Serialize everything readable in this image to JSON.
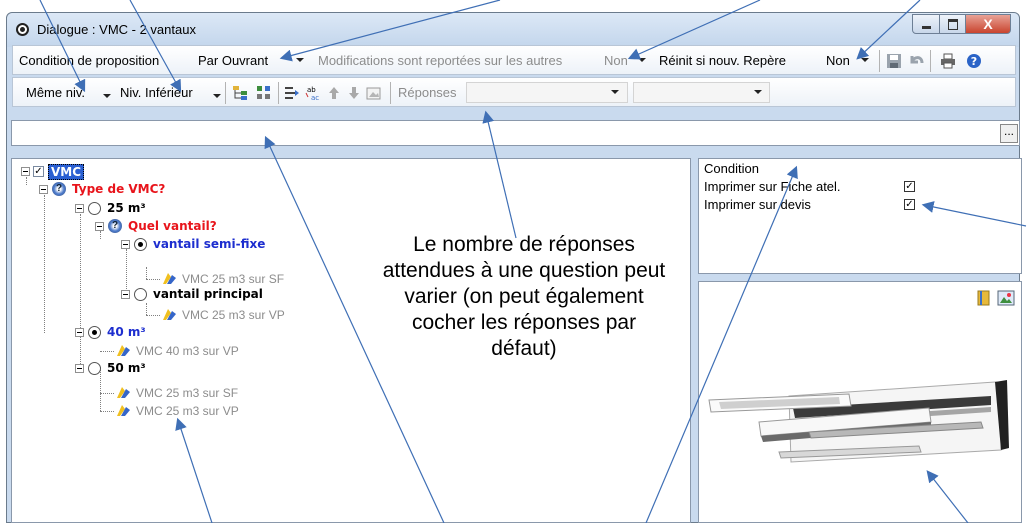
{
  "window": {
    "title": "Dialogue : VMC - 2 vantaux",
    "app_icon": "app-logo-icon",
    "controls": {
      "minimize": "minimize-icon",
      "maximize": "maximize-icon",
      "close": "X"
    }
  },
  "toolbar1": {
    "condition_label": "Condition de proposition",
    "condition_value": "Par Ouvrant",
    "modifications_label": "Modifications sont reportées sur les autres",
    "modifications_value": "Non",
    "reinit_label": "Réinit si nouv. Repère",
    "reinit_value": "Non",
    "icons": [
      "save-icon",
      "undo-icon",
      "print-icon",
      "help-icon"
    ]
  },
  "toolbar2": {
    "same_level": "Même niv.",
    "lower_level": "Niv. Inférieur",
    "icons": [
      "tree-expand-icon",
      "tree-grid-icon",
      "indent-icon",
      "rename-icon",
      "move-up-icon",
      "move-down-icon",
      "image-icon"
    ],
    "responses_label": "Réponses",
    "combo1_value": "",
    "combo2_value": ""
  },
  "formula_bar": {
    "value": "",
    "button": "..."
  },
  "tree": {
    "root": "VMC",
    "q1": "Type de VMC?",
    "a1": "25 m³",
    "q2": "Quel vantail?",
    "a2a": "vantail semi-fixe",
    "leaf1": "VMC 25 m3 sur SF",
    "a2b": "vantail principal",
    "leaf2": "VMC 25 m3 sur VP",
    "a3": "40 m³",
    "leaf3": "VMC 40 m3 sur VP",
    "a4": "50 m³",
    "leaf4": "VMC 25 m3 sur SF",
    "leaf5": "VMC 25 m3 sur VP"
  },
  "annotation": "Le nombre de réponses attendues à une question peut varier (on peut également cocher les réponses par défaut)",
  "condition_panel": {
    "title": "Condition",
    "print_sheet_label": "Imprimer sur Fiche atel.",
    "print_sheet_checked": true,
    "print_quote_label": "Imprimer sur devis",
    "print_quote_checked": true
  },
  "image_panel": {
    "icons": [
      "book-icon",
      "picture-icon"
    ]
  },
  "colors": {
    "question": "#e8141b",
    "selected_answer": "#1d2ecf",
    "leaf": "#8c8c8c",
    "arrow": "#3f6fb5"
  }
}
